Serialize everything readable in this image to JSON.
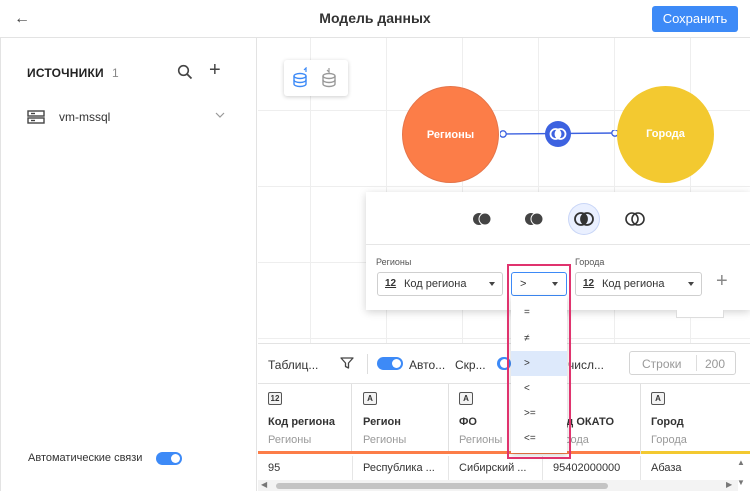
{
  "header": {
    "title": "Модель данных",
    "save_label": "Сохранить"
  },
  "sidebar": {
    "title": "ИСТОЧНИКИ",
    "count": "1",
    "sources": [
      {
        "name": "vm-mssql",
        "icon": "database-server-icon"
      }
    ],
    "auto_links_label": "Автоматические связи",
    "auto_links_on": true
  },
  "canvas": {
    "nodes": [
      {
        "name": "Регионы",
        "color": "#fc7d48"
      },
      {
        "name": "Города",
        "color": "#f3c930"
      }
    ],
    "join_color": "#3d62e0"
  },
  "join_panel": {
    "left_source_label": "Регионы",
    "right_source_label": "Города",
    "left_field": {
      "type": "12",
      "name": "Код региона"
    },
    "right_field": {
      "type": "12",
      "name": "Код региона"
    },
    "operator": ">",
    "operator_options": [
      "=",
      "≠",
      ">",
      "<",
      ">=",
      "<="
    ],
    "selected_operator_index": 2
  },
  "toolbar": {
    "table_label": "Таблиц...",
    "auto_label": "Авто...",
    "hide_label": "Скр...",
    "calc_label": "числ...",
    "rows_label": "Строки",
    "rows_value": "200"
  },
  "table": {
    "columns": [
      {
        "type": "12",
        "name": "Код региона",
        "source": "Регионы"
      },
      {
        "type": "A",
        "name": "Регион",
        "source": "Регионы"
      },
      {
        "type": "A",
        "name": "ФО",
        "source": "Регионы"
      },
      {
        "type": "12",
        "name": "Код ОКАТО",
        "source": "Города"
      },
      {
        "type": "A",
        "name": "Город",
        "source": "Города"
      }
    ],
    "rows": [
      [
        "95",
        "Республика ...",
        "Сибирский ...",
        "95402000000",
        "Абаза"
      ]
    ]
  },
  "colors": {
    "accent": "#3d8af7",
    "highlight": "#e0336e"
  }
}
